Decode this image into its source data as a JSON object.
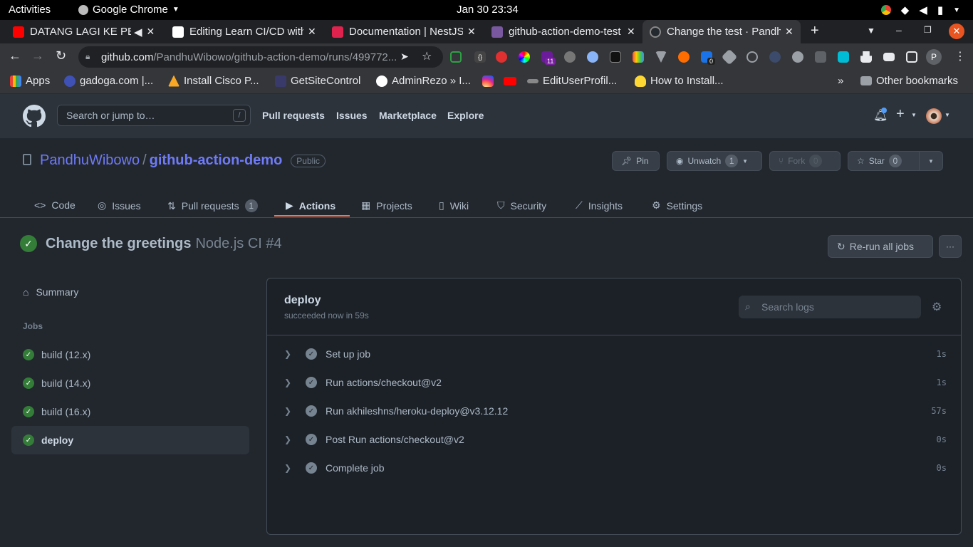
{
  "os": {
    "activities": "Activities",
    "app_name": "Google Chrome",
    "clock": "Jan 30  23:34"
  },
  "tabs": [
    {
      "title": "DATANG LAGI KE PERNIKAHAN",
      "color": "#ff0000"
    },
    {
      "title": "Editing Learn CI/CD with GitHub",
      "color": "#ffffff"
    },
    {
      "title": "Documentation | NestJS",
      "color": "#e0234e"
    },
    {
      "title": "github-action-demo-test",
      "color": "#79589f"
    },
    {
      "title": "Change the test · PandhuWibowo",
      "color": "#24292f"
    }
  ],
  "address": {
    "host": "github.com",
    "path": "/PandhuWibowo/github-action-demo/runs/499772..."
  },
  "extensions": {
    "badge_1": "11",
    "badge_2": "0"
  },
  "bookmarks": [
    {
      "label": "Apps"
    },
    {
      "label": "gadoga.com |..."
    },
    {
      "label": "Install Cisco P..."
    },
    {
      "label": "GetSiteControl"
    },
    {
      "label": "AdminRezo » I..."
    },
    {
      "label": "EditUserProfil..."
    },
    {
      "label": "How to Install..."
    },
    {
      "label": "»"
    },
    {
      "label": "Other bookmarks"
    }
  ],
  "github": {
    "search_placeholder": "Search or jump to…",
    "slash": "/",
    "nav": [
      "Pull requests",
      "Issues",
      "Marketplace",
      "Explore"
    ]
  },
  "repo": {
    "owner": "PandhuWibowo",
    "sep": "/",
    "name": "github-action-demo",
    "visibility": "Public",
    "pin": "Pin",
    "unwatch": "Unwatch",
    "watch_count": "1",
    "fork": "Fork",
    "fork_count": "0",
    "star": "Star",
    "star_count": "0",
    "tabs": [
      {
        "label": "Code"
      },
      {
        "label": "Issues"
      },
      {
        "label": "Pull requests",
        "count": "1"
      },
      {
        "label": "Actions"
      },
      {
        "label": "Projects"
      },
      {
        "label": "Wiki"
      },
      {
        "label": "Security"
      },
      {
        "label": "Insights"
      },
      {
        "label": "Settings"
      }
    ]
  },
  "run": {
    "title": "Change the greetings",
    "workflow": "Node.js CI #4",
    "rerun": "Re-run all jobs",
    "more": "···"
  },
  "sidebar": {
    "summary": "Summary",
    "jobs_heading": "Jobs",
    "jobs": [
      {
        "label": "build (12.x)"
      },
      {
        "label": "build (14.x)"
      },
      {
        "label": "build (16.x)"
      },
      {
        "label": "deploy"
      }
    ]
  },
  "job": {
    "name": "deploy",
    "status": "succeeded now in 59s",
    "search_placeholder": "Search logs",
    "steps": [
      {
        "label": "Set up job",
        "duration": "1s"
      },
      {
        "label": "Run actions/checkout@v2",
        "duration": "1s"
      },
      {
        "label": "Run akhileshns/heroku-deploy@v3.12.12",
        "duration": "57s"
      },
      {
        "label": "Post Run actions/checkout@v2",
        "duration": "0s"
      },
      {
        "label": "Complete job",
        "duration": "0s"
      }
    ]
  }
}
